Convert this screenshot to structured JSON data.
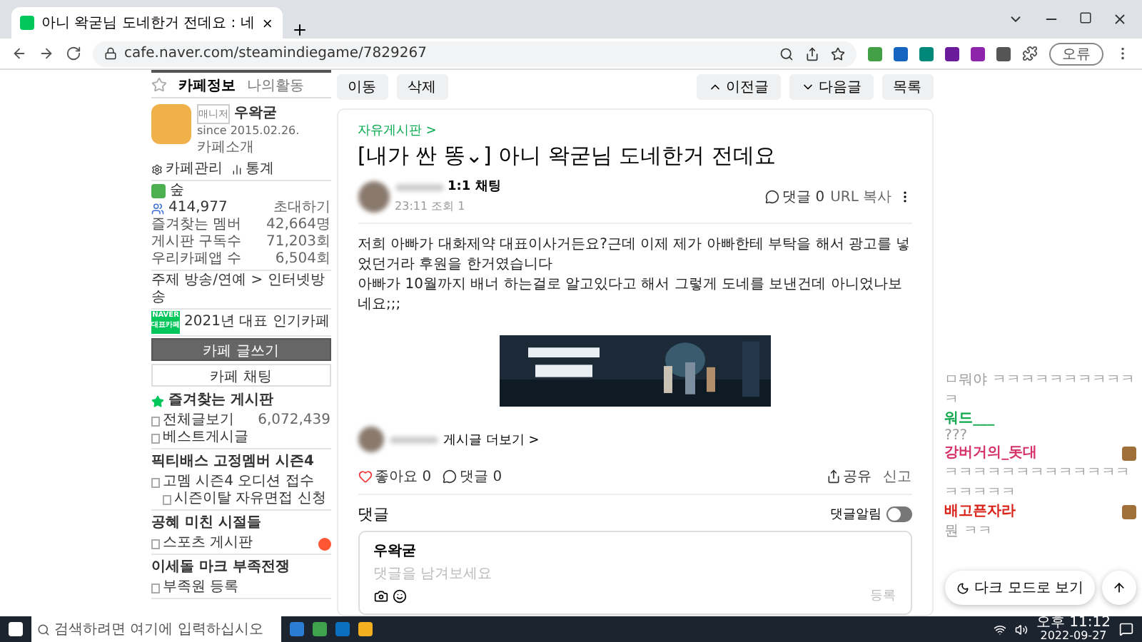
{
  "browser": {
    "tab_title": "아니 왁굳님 도네한거 전데요 : 네",
    "url": "cafe.naver.com/steamindiegame/7829267",
    "profile_label": "오류"
  },
  "sidebar": {
    "tabs": [
      {
        "label": "카페정보",
        "selected": true
      },
      {
        "label": "나의활동",
        "selected": false
      }
    ],
    "cafe": {
      "role": "매니저",
      "manager": "우왁굳",
      "since": "since 2015.02.26.",
      "intro": "카페소개",
      "links": [
        "카페관리",
        "통계"
      ],
      "grade": "숲",
      "members": "414,977",
      "invite": "초대하기"
    },
    "stats": [
      {
        "label": "즐겨찾는 멤버",
        "value": "42,664명"
      },
      {
        "label": "게시판 구독수",
        "value": "71,203회"
      },
      {
        "label": "우리카페앱 수",
        "value": "6,504회"
      }
    ],
    "topic": "주제 방송/연예 > 인터넷방송",
    "badge": {
      "line1": "NAVER",
      "line2": "대표카페"
    },
    "award": "2021년 대표 인기카페",
    "write_button": "카페 글쓰기",
    "chat_button": "카페 채팅",
    "boards": [
      {
        "title": "즐겨찾는 게시판",
        "kind": "favorites",
        "items": [
          {
            "label": "전체글보기",
            "count": "6,072,439"
          },
          {
            "label": "베스트게시글"
          }
        ]
      },
      {
        "title": "픽티배스 고정멤버 시즌4",
        "kind": "section",
        "items": [
          {
            "label": "고멤 시즌4 오디션 접수",
            "children": [
              {
                "label": "시즌이탈 자유면접 신청"
              }
            ]
          }
        ]
      },
      {
        "title": "공혜 미친 시절들",
        "kind": "section",
        "items": [
          {
            "label": "스포츠 게시판",
            "new": true
          }
        ]
      },
      {
        "title": "이세돌 마크 부족전쟁",
        "kind": "section",
        "items": [
          {
            "label": "부족원 등록"
          }
        ]
      }
    ]
  },
  "toolbar": {
    "left": [
      "이동",
      "삭제"
    ],
    "right": [
      {
        "label": "이전글",
        "kind": "up"
      },
      {
        "label": "다음글",
        "kind": "down"
      },
      {
        "label": "목록",
        "kind": "plain"
      }
    ]
  },
  "article": {
    "board": "자유게시판 >",
    "title": "[내가 싼 똥⌄] 아니 왁굳님 도네한거 전데요",
    "chat": "1:1 채팅",
    "meta": "23:11 조회 1",
    "comment_count": "댓글 0",
    "url_copy": "URL 복사",
    "body": [
      "저희 아빠가 대화제약 대표이사거든요?근데 이제 제가 아빠한테 부탁을 해서 광고를 넣었던거라 후원을 한거였습니다",
      "아빠가 10월까지 배너 하는걸로 알고있다고 해서 그렇게 도네를 보낸건데 아니었나보네요;;;"
    ],
    "more_posts": "게시글 더보기 >",
    "like": "좋아요 0",
    "comments": "댓글 0",
    "share": "공유",
    "report": "신고"
  },
  "comments": {
    "title": "댓글",
    "notify_label": "댓글알림",
    "notify_on": false,
    "writer": "우왁굳",
    "placeholder": "댓글을 남겨보세요",
    "submit": "등록"
  },
  "chat": [
    {
      "text": "ㅁ뭐야 ㅋㅋㅋㅋㅋㅋㅋㅋㅋㅋㅋ"
    },
    {
      "name": "워드___",
      "color": "#11a84e",
      "text": "???",
      "avatar": false
    },
    {
      "name": "강버거의_돗대",
      "color": "#d6336c",
      "text": "ㅋㅋㅋㅋㅋㅋㅋㅋㅋㅋㅋㅋㅋㅋㅋㅋㅋㅋ",
      "avatar": true
    },
    {
      "name": "배고픈자라",
      "color": "#d9231a",
      "text": "뭔 ㅋㅋ",
      "avatar": true
    }
  ],
  "dark_mode_button": "다크 모드로 보기",
  "taskbar": {
    "search_placeholder": "검색하려면 여기에 입력하십시오",
    "time": "오후 11:12",
    "date": "2022-09-27"
  }
}
